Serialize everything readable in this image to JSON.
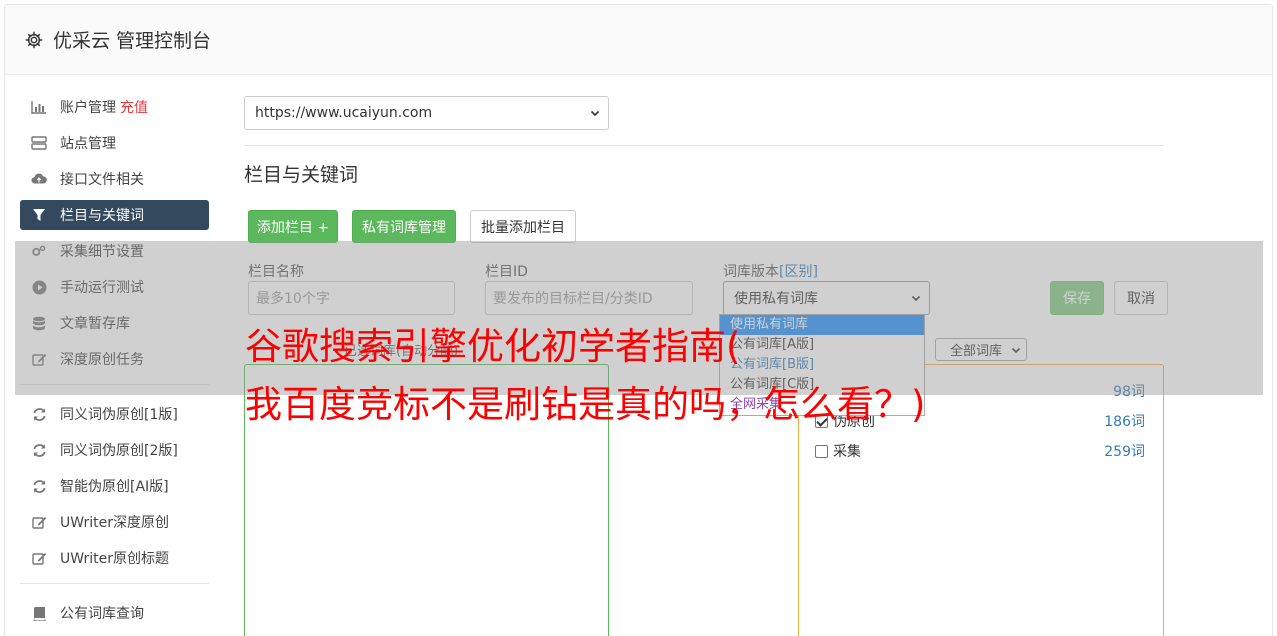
{
  "header": {
    "title": "优采云 管理控制台"
  },
  "sidebar": {
    "group1": [
      {
        "label": "账户管理",
        "icon": "bar-chart-icon",
        "badge": "充值"
      },
      {
        "label": "站点管理",
        "icon": "server-icon"
      },
      {
        "label": "接口文件相关",
        "icon": "cloud-upload-icon"
      },
      {
        "label": "栏目与关键词",
        "icon": "filter-icon",
        "active": true
      },
      {
        "label": "采集细节设置",
        "icon": "cogs-icon"
      },
      {
        "label": "手动运行测试",
        "icon": "play-circle-icon"
      },
      {
        "label": "文章暂存库",
        "icon": "database-icon"
      },
      {
        "label": "深度原创任务",
        "icon": "edit-icon"
      }
    ],
    "group2": [
      {
        "label": "同义词伪原创[1版]",
        "icon": "refresh-icon"
      },
      {
        "label": "同义词伪原创[2版]",
        "icon": "refresh-icon"
      },
      {
        "label": "智能伪原创[AI版]",
        "icon": "refresh-icon"
      },
      {
        "label": "UWriter深度原创",
        "icon": "edit-icon"
      },
      {
        "label": "UWriter原创标题",
        "icon": "edit-icon"
      }
    ],
    "group3": [
      {
        "label": "公有词库查询",
        "icon": "book-icon"
      }
    ]
  },
  "main": {
    "site_select": "https://www.ucaiyun.com",
    "section_title": "栏目与关键词",
    "buttons": {
      "add_column": "添加栏目 +",
      "private_lib": "私有词库管理",
      "batch_add": "批量添加栏目"
    },
    "form": {
      "name_label": "栏目名称",
      "name_placeholder": "最多10个字",
      "id_label": "栏目ID",
      "id_placeholder": "要发布的目标栏目/分类ID",
      "version_label": "词库版本",
      "version_link": "[区别]",
      "version_value": "使用私有词库",
      "save": "保存",
      "cancel": "取消"
    },
    "dropdown_options": [
      "使用私有词库",
      "公有词库[A版]",
      "公有词库[B版]",
      "公有词库[C版]",
      "全网采集"
    ],
    "scope_label": "已选词库(自动分配)",
    "lib_filter": "全部词库",
    "libraries": [
      {
        "label": "",
        "count": "98词",
        "checked": false
      },
      {
        "label": "伪原创",
        "count": "186词",
        "checked": true
      },
      {
        "label": "采集",
        "count": "259词",
        "checked": false
      }
    ]
  },
  "overlay_text": {
    "line1": "谷歌搜索引擎优化初学者指南(",
    "line2": "我百度竞标不是刷钻是真的吗，怎么看？)"
  },
  "colors": {
    "green": "#5cb85c",
    "active_nav": "#34495e",
    "overlay_text": "#ff0000",
    "charge": "#e4393c"
  }
}
